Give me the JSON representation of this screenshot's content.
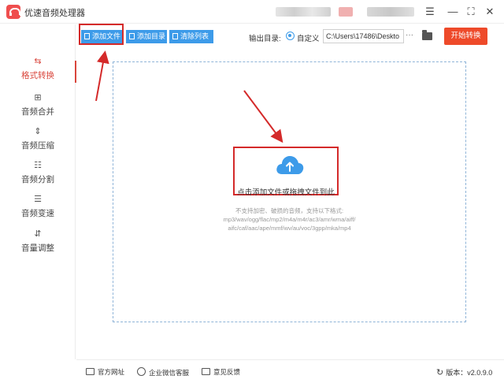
{
  "app": {
    "title": "优速音频处理器"
  },
  "window_controls": {
    "menu": "☰",
    "minimize": "—",
    "maximize": "⛶",
    "close": "✕"
  },
  "sidebar": {
    "items": [
      {
        "label": "格式转换",
        "icon": "format-convert-icon",
        "glyph": "⇆",
        "active": true
      },
      {
        "label": "音频合并",
        "icon": "merge-icon",
        "glyph": "⊞",
        "active": false
      },
      {
        "label": "音频压缩",
        "icon": "compress-icon",
        "glyph": "⇕",
        "active": false
      },
      {
        "label": "音频分割",
        "icon": "split-icon",
        "glyph": "☷",
        "active": false
      },
      {
        "label": "音频变速",
        "icon": "speed-icon",
        "glyph": "☰",
        "active": false
      },
      {
        "label": "音量调整",
        "icon": "volume-icon",
        "glyph": "⇵",
        "active": false
      }
    ]
  },
  "toolbar": {
    "add_file": "添加文件",
    "add_folder": "添加目录",
    "clear_list": "清除列表",
    "output_label": "输出目录:",
    "custom_option": "自定义",
    "output_path": "C:\\Users\\17486\\Deskto",
    "browse": "···",
    "convert": "开始转换"
  },
  "drop_zone": {
    "prompt": "点击添加文件或拖拽文件到此",
    "hint_line1": "不支持加密、破损的音频，支持以下格式:",
    "hint_line2": "mp3/wav/ogg/flac/mp2/m4a/m4r/ac3/amr/wma/aiff/",
    "hint_line3": "aifc/caf/aac/ape/mmf/wv/au/voc/3gpp/mka/mp4"
  },
  "footer": {
    "website": "官方网址",
    "wechat_support": "企业微信客服",
    "feedback": "意见反馈",
    "version_label": "版本：",
    "version": "v2.0.9.0"
  },
  "colors": {
    "accent_blue": "#3d9be9",
    "convert_red": "#ee4a2a",
    "annotation_red": "#d42a2a",
    "active_red": "#d9463c"
  }
}
